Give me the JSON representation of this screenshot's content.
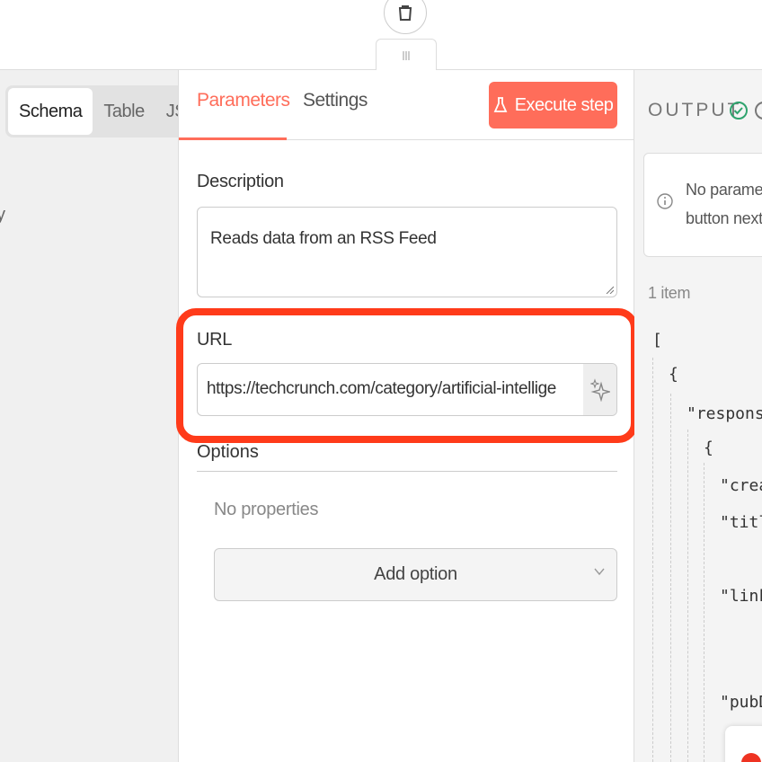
{
  "left": {
    "view_tabs": [
      "Schema",
      "Table",
      "JSON"
    ],
    "active_view": "Schema",
    "partial_text": "y"
  },
  "center": {
    "tabs": {
      "parameters": "Parameters",
      "settings": "Settings"
    },
    "execute_button": "Execute step",
    "description": {
      "label": "Description",
      "value": "Reads data from an RSS Feed"
    },
    "url": {
      "label": "URL",
      "value": "https://techcrunch.com/category/artificial-intelligence/feed/"
    },
    "options": {
      "label": "Options",
      "empty_text": "No properties",
      "add_button": "Add option"
    }
  },
  "output": {
    "title": "OUTPUT",
    "notice_line1": "No parameters are set up to be filled by AI. Click on the",
    "notice_line2": "button next to a parameter",
    "item_count": "1 item",
    "json_lines": {
      "open_bracket": "[",
      "open_brace": "{",
      "response_key": "\"response\"",
      "inner_brace": "{",
      "created_key": "\"creat",
      "title_key": "\"title",
      "link_key": "\"link\"",
      "pubdate_key": "\"pubDa"
    }
  },
  "colors": {
    "accent": "#ff6d5a",
    "highlight": "#ff3b1a",
    "success": "#2ea36d"
  }
}
